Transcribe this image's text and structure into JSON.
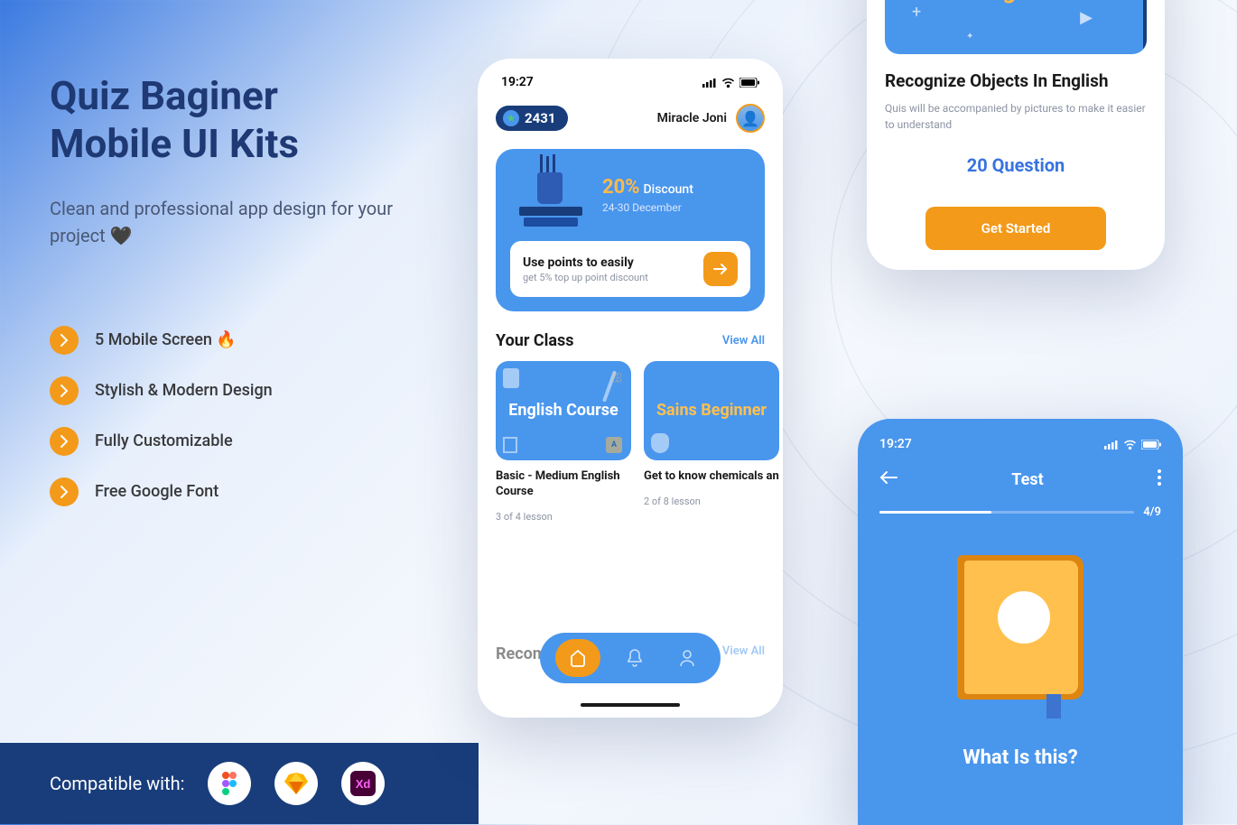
{
  "hero": {
    "title_l1": "Quiz Baginer",
    "title_l2": "Mobile UI Kits",
    "subtitle": "Clean and professional app design for your project 🖤"
  },
  "features": [
    "5 Mobile Screen 🔥",
    "Stylish & Modern Design",
    "Fully Customizable",
    "Free Google Font"
  ],
  "footer": {
    "label": "Compatible with:",
    "apps": [
      "figma",
      "sketch",
      "xd"
    ]
  },
  "phone1": {
    "time": "19:27",
    "points": "2431",
    "user": "Miracle Joni",
    "promo_percent": "20%",
    "promo_discount": "Discount",
    "promo_date": "24-30 December",
    "promo_card_title": "Use points to easily",
    "promo_card_sub": "get 5% top up point discount",
    "section_class": "Your Class",
    "view_all": "View All",
    "class1_img": "English Course",
    "class1_title": "Basic - Medium English Course",
    "class1_meta": "3 of 4 lesson",
    "class2_img": "Sains Beginner",
    "class2_title": "Get to know chemicals and their ingredients",
    "class2_meta": "2 of 8 lesson",
    "section_rec": "Recomendation"
  },
  "phone2": {
    "brand": "Baginer",
    "title": "Recognize Objects In English",
    "desc": "Quis will be accompanied by pictures to make it easier to understand",
    "question_count": "20 Question",
    "button": "Get Started"
  },
  "phone3": {
    "time": "19:27",
    "title": "Test",
    "progress": "4/9",
    "question": "What Is this?"
  }
}
